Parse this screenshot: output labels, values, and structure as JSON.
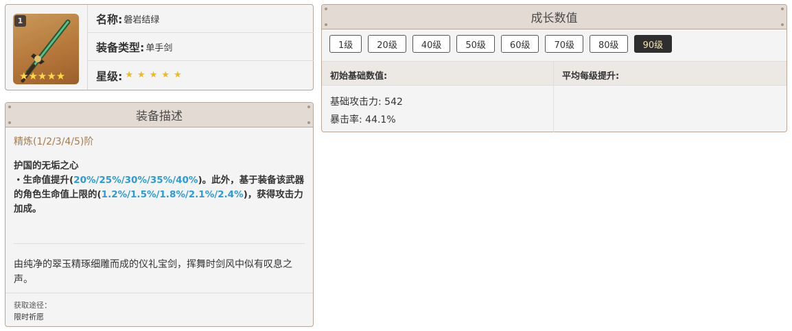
{
  "info": {
    "rank_badge": "1",
    "icon_stars": "★★★★★",
    "name_label": "名称:",
    "name_value": "磐岩结绿",
    "type_label": "装备类型:",
    "type_value": "单手剑",
    "rarity_label": "星级:",
    "rarity_stars": "★★★★★"
  },
  "description": {
    "header": "装备描述",
    "refine_title": "精炼(1/2/3/4/5)阶",
    "passive_name": "护国的无垢之心",
    "passive_part1": "・生命值提升(",
    "passive_hp_values": "20%/25%/30%/35%/40%",
    "passive_part2": ")。此外，基于装备该武器的角色生命值上限的(",
    "passive_atk_values": "1.2%/1.5%/1.8%/2.1%/2.4%",
    "passive_part3": ")，获得攻击力加成。",
    "flavor": "由纯净的翠玉精琢细雕而成的仪礼宝剑，挥舞时剑风中似有叹息之声。",
    "obtain_label": "获取途径：",
    "obtain_value": "限时祈愿"
  },
  "growth": {
    "header": "成长数值",
    "levels": [
      "1级",
      "20级",
      "40级",
      "50级",
      "60级",
      "70级",
      "80级",
      "90级"
    ],
    "active_level": "90级",
    "base_title": "初始基础数值:",
    "per_level_title": "平均每级提升:",
    "base_atk": "基础攻击力: 542",
    "crit_rate": "暴击率: 44.1%"
  },
  "colors": {
    "highlight": "#2a9bd8",
    "refine": "#a57b4c",
    "border": "#b7a79a",
    "header_bg": "#e3dbd3",
    "active_button_bg": "#2e2e2e",
    "active_button_text": "#f4e2b3"
  }
}
